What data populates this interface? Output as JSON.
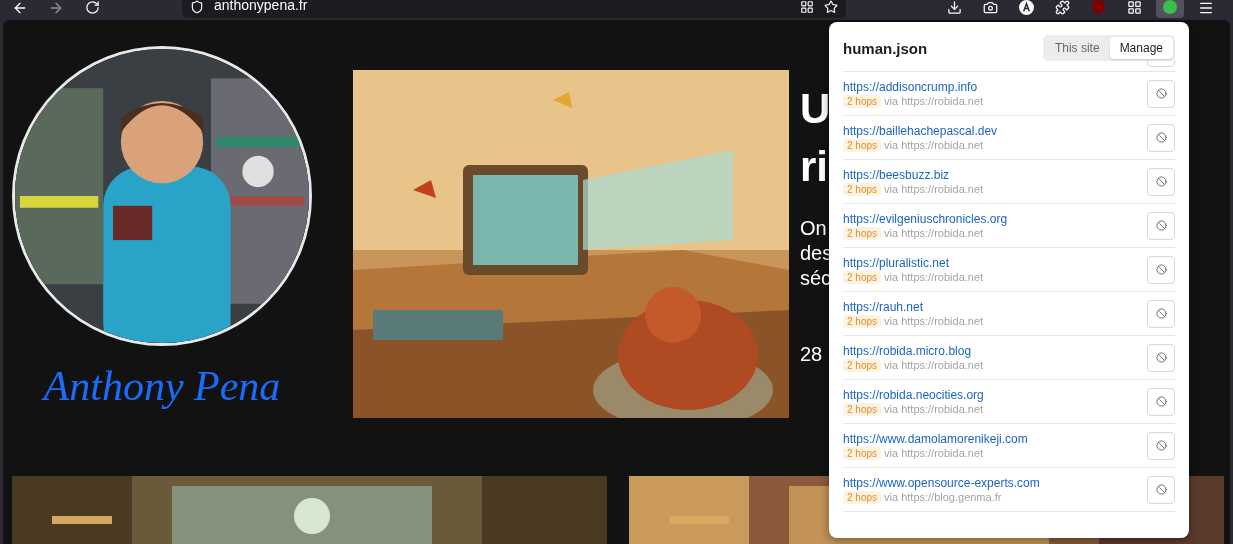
{
  "browser": {
    "address": "anthonypena.fr"
  },
  "page": {
    "signature": "Anthony Pena",
    "headline": [
      "U",
      "ri"
    ],
    "excerpt": [
      "On",
      "des",
      "séc"
    ],
    "date": "28"
  },
  "popup": {
    "title": "human.json",
    "tabs": [
      {
        "label": "This site",
        "selected": false
      },
      {
        "label": "Manage",
        "selected": true
      }
    ],
    "entries": [
      {
        "url": "https://addisoncrump.info",
        "hops": "2 hops",
        "via": "via https://robida.net"
      },
      {
        "url": "https://baillehachepascal.dev",
        "hops": "2 hops",
        "via": "via https://robida.net"
      },
      {
        "url": "https://beesbuzz.biz",
        "hops": "2 hops",
        "via": "via https://robida.net"
      },
      {
        "url": "https://evilgeniuschronicles.org",
        "hops": "2 hops",
        "via": "via https://robida.net"
      },
      {
        "url": "https://pluralistic.net",
        "hops": "2 hops",
        "via": "via https://robida.net"
      },
      {
        "url": "https://rauh.net",
        "hops": "2 hops",
        "via": "via https://robida.net"
      },
      {
        "url": "https://robida.micro.blog",
        "hops": "2 hops",
        "via": "via https://robida.net"
      },
      {
        "url": "https://robida.neocities.org",
        "hops": "2 hops",
        "via": "via https://robida.net"
      },
      {
        "url": "https://www.damolamorenikeji.com",
        "hops": "2 hops",
        "via": "via https://robida.net"
      },
      {
        "url": "https://www.opensource-experts.com",
        "hops": "2 hops",
        "via": "via https://blog.genma.fr"
      }
    ]
  }
}
